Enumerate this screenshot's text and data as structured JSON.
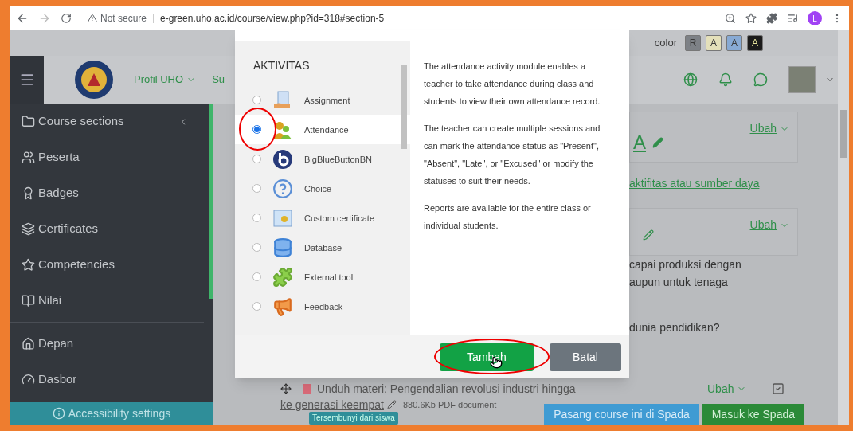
{
  "browser": {
    "security": "Not secure",
    "url": "e-green.uho.ac.id/course/view.php?id=318#section-5",
    "profile_initial": "L"
  },
  "accessibility_bar": {
    "label": "color",
    "swatches": [
      {
        "text": "R",
        "color": "#7d8186"
      },
      {
        "text": "A",
        "color": "#e4e0ba"
      },
      {
        "text": "A",
        "color": "#88aad4"
      },
      {
        "text": "A",
        "color": "#1b1b1b"
      }
    ]
  },
  "navbar": {
    "menu": [
      {
        "label": "Profil UHO",
        "dropdown": true
      },
      {
        "label": "Su",
        "dropdown": false
      }
    ]
  },
  "sidebar": {
    "course_items": [
      {
        "label": "Course sections",
        "collapsible": true
      },
      {
        "label": "Peserta",
        "collapsible": false
      },
      {
        "label": "Badges",
        "collapsible": false
      },
      {
        "label": "Certificates",
        "collapsible": false
      },
      {
        "label": "Competencies",
        "collapsible": false
      },
      {
        "label": "Nilai",
        "collapsible": false
      }
    ],
    "site_items": [
      {
        "label": "Depan"
      },
      {
        "label": "Dasbor"
      }
    ],
    "footer": "Accessibility settings"
  },
  "course": {
    "section_title": "A",
    "section_edit": "Ubah",
    "add_link": "aktifitas atau sumber daya",
    "card_edit": "Ubah",
    "text_lines": [
      "capai produksi dengan",
      "aupun untuk tenaga"
    ],
    "question": "dunia pendidikan?",
    "resource": {
      "title_lines": [
        "Unduh materi: Pengendalian revolusi industri hingga",
        "ke generasi keempat"
      ],
      "size": "880.6Kb PDF document",
      "badge": "Tersembunyi dari siswa",
      "edit": "Ubah",
      "checked": true
    },
    "footer_buttons": [
      "Pasang course ini di Spada",
      "Masuk ke Spada"
    ]
  },
  "modal": {
    "heading": "AKTIVITAS",
    "activities": [
      {
        "label": "Assignment",
        "selected": false
      },
      {
        "label": "Attendance",
        "selected": true
      },
      {
        "label": "BigBlueButtonBN",
        "selected": false
      },
      {
        "label": "Choice",
        "selected": false
      },
      {
        "label": "Custom certificate",
        "selected": false
      },
      {
        "label": "Database",
        "selected": false
      },
      {
        "label": "External tool",
        "selected": false
      },
      {
        "label": "Feedback",
        "selected": false
      }
    ],
    "description": [
      "The attendance activity module enables a teacher to take attendance during class and students to view their own attendance record.",
      "The teacher can create multiple sessions and can mark the attendance status as \"Present\", \"Absent\", \"Late\", or \"Excused\" or modify the statuses to suit their needs.",
      "Reports are available for the entire class or individual students."
    ],
    "buttons": [
      {
        "label": "Tambah",
        "kind": "primary"
      },
      {
        "label": "Batal",
        "kind": "secondary"
      }
    ]
  }
}
